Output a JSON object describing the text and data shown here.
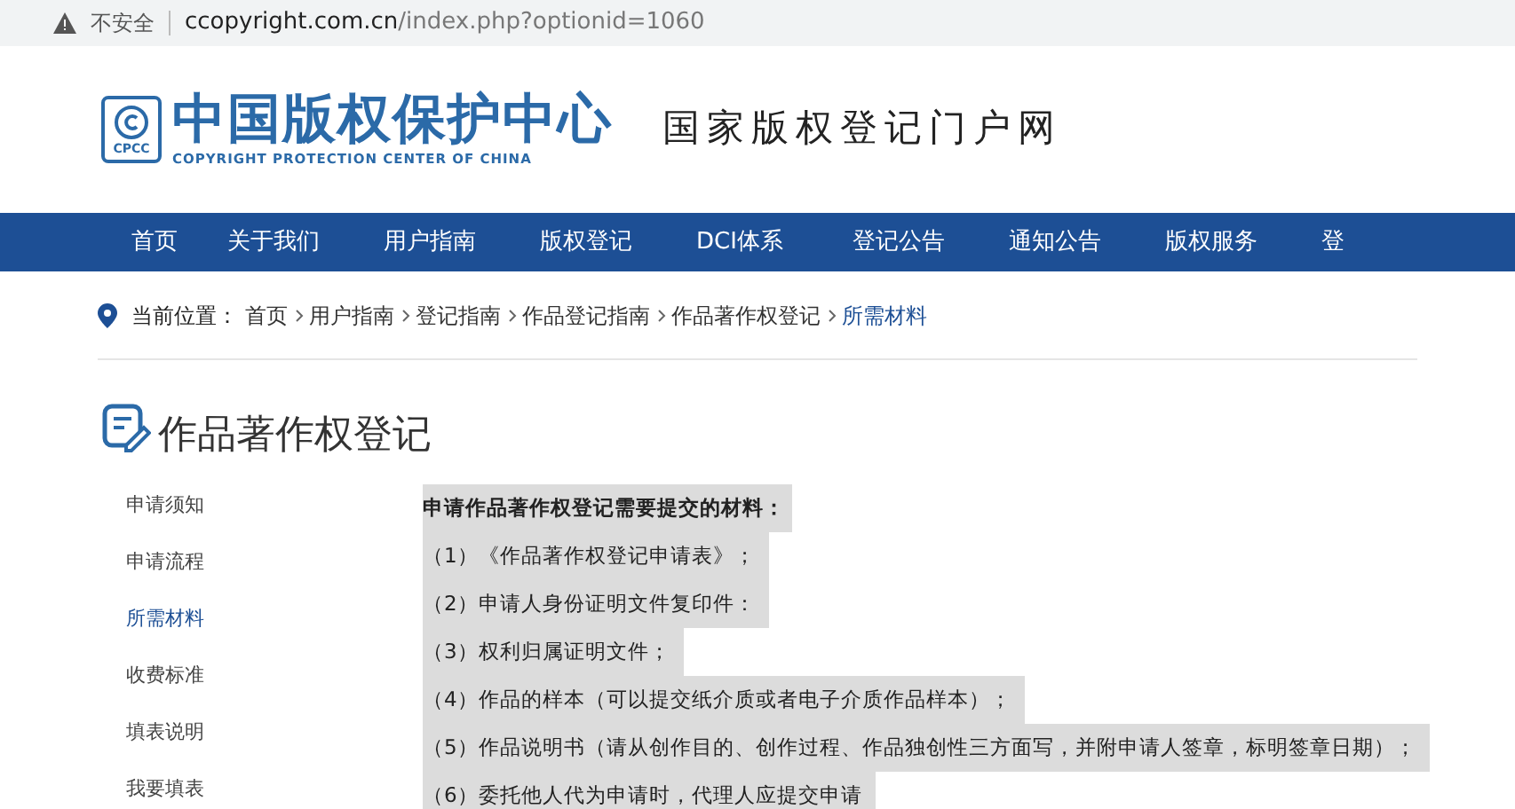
{
  "browser": {
    "security": "不安全",
    "url_host": "ccopyright.com.cn",
    "url_path": "/index.php?optionid=1060"
  },
  "header": {
    "logo_title": "中国版权保护中心",
    "logo_abbr": "CPCC",
    "logo_subtitle": "COPYRIGHT PROTECTION CENTER OF CHINA",
    "slogan": "国家版权登记门户网"
  },
  "nav": [
    {
      "label": "首页"
    },
    {
      "label": "关于我们"
    },
    {
      "label": "用户指南"
    },
    {
      "label": "版权登记"
    },
    {
      "label": "DCI体系"
    },
    {
      "label": "登记公告"
    },
    {
      "label": "通知公告"
    },
    {
      "label": "版权服务"
    },
    {
      "label": "登"
    }
  ],
  "breadcrumb": {
    "label": "当前位置：",
    "items": [
      {
        "label": "首页",
        "selected": false
      },
      {
        "label": "用户指南",
        "selected": false
      },
      {
        "label": "登记指南",
        "selected": false
      },
      {
        "label": "作品登记指南",
        "selected": false
      },
      {
        "label": "作品著作权登记",
        "selected": false
      },
      {
        "label": "所需材料",
        "selected": true
      }
    ]
  },
  "page_title": "作品著作权登记",
  "sidebar": [
    {
      "label": "申请须知",
      "selected": false
    },
    {
      "label": "申请流程",
      "selected": false
    },
    {
      "label": "所需材料",
      "selected": true
    },
    {
      "label": "收费标准",
      "selected": false
    },
    {
      "label": "填表说明",
      "selected": false
    },
    {
      "label": "我要填表",
      "selected": false
    }
  ],
  "content": {
    "heading": "申请作品著作权登记需要提交的材料：",
    "items": [
      "（1）《作品著作权登记申请表》；",
      "（2）申请人身份证明文件复印件：",
      "（3）权利归属证明文件；",
      "（4）作品的样本（可以提交纸介质或者电子介质作品样本）；",
      "（5）作品说明书（请从创作目的、创作过程、作品独创性三方面写，并附申请人签章，标明签章日期）；",
      "（6）委托他人代为申请时，代理人应提交申请"
    ]
  }
}
